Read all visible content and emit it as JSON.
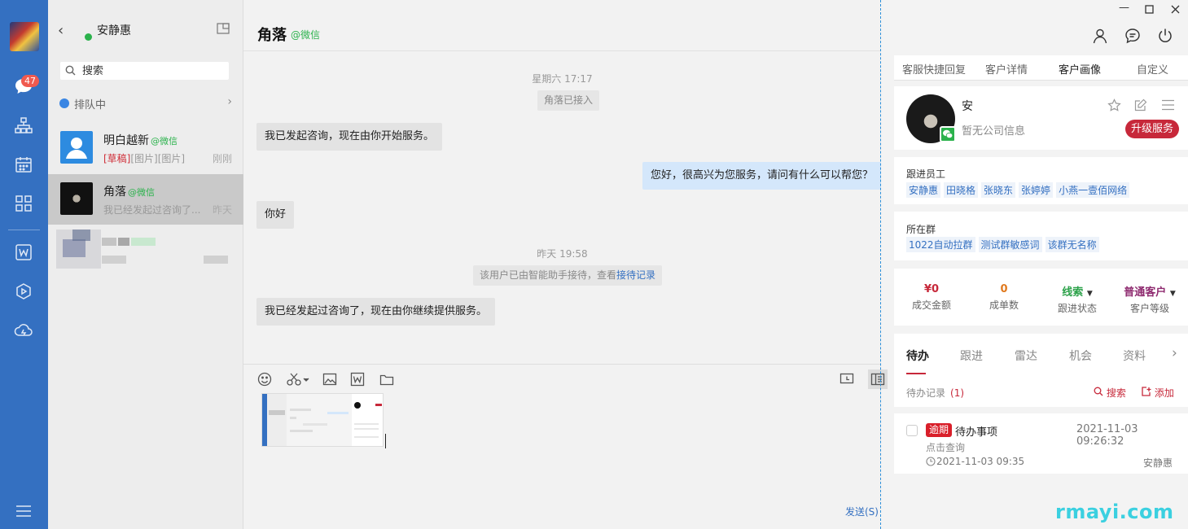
{
  "rail": {
    "unread_badge": "47"
  },
  "convpanel": {
    "agent_name": "安静惠",
    "search_placeholder": "搜索",
    "queue_label": "排队中",
    "conversations": [
      {
        "name": "明白越新",
        "source": "@微信",
        "draft_tag": "[草稿]",
        "preview": "[图片][图片]",
        "time": "刚刚"
      },
      {
        "name": "角落",
        "source": "@微信",
        "preview": "我已经发起过咨询了...",
        "time": "昨天"
      }
    ]
  },
  "chat": {
    "title": "角落",
    "source": "@微信",
    "stamp1": "星期六 17:17",
    "sys1": "角落已接入",
    "msg1": "我已发起咨询，现在由你开始服务。",
    "msg2": "您好，很高兴为您服务，请问有什么可以帮您？",
    "msg3": "你好",
    "stamp2": "昨天 19:58",
    "sys2_text": "该用户已由智能助手接待，查看",
    "sys2_link": "接待记录",
    "msg4": "我已经发起过咨询了，现在由你继续提供服务。",
    "send_label": "发送(S)"
  },
  "right": {
    "tabs": [
      "客服快捷回复",
      "客户详情",
      "客户画像",
      "自定义"
    ],
    "active_tab": "客户画像",
    "customer_name": "安",
    "company": "暂无公司信息",
    "upgrade_label": "升级服务",
    "staff_label": "跟进员工",
    "staff": [
      "安静惠",
      "田晓格",
      "张晓东",
      "张婷婷",
      "小燕一壹佰网络"
    ],
    "group_label": "所在群",
    "groups": [
      "1022自动拉群",
      "测试群敏感词",
      "该群无名称"
    ],
    "stats": [
      {
        "value": "¥0",
        "label": "成交金额",
        "color": "#c7283a"
      },
      {
        "value": "0",
        "label": "成单数",
        "color": "#e07a1f"
      },
      {
        "value": "线索",
        "label": "跟进状态",
        "color": "#2ca24a"
      },
      {
        "value": "普通客户",
        "label": "客户等级",
        "color": "#8e2a6f"
      }
    ],
    "subtabs": [
      "待办",
      "跟进",
      "雷达",
      "机会",
      "资料"
    ],
    "todo_label": "待办记录",
    "todo_count": "(1)",
    "search_label": "搜索",
    "add_label": "添加",
    "task": {
      "badge": "逾期",
      "title": "待办事项",
      "created": "2021-11-03 09:26:32",
      "detail": "点击查询",
      "due": "2021-11-03 09:35",
      "owner": "安静惠"
    }
  },
  "watermark": "rmayi.com"
}
